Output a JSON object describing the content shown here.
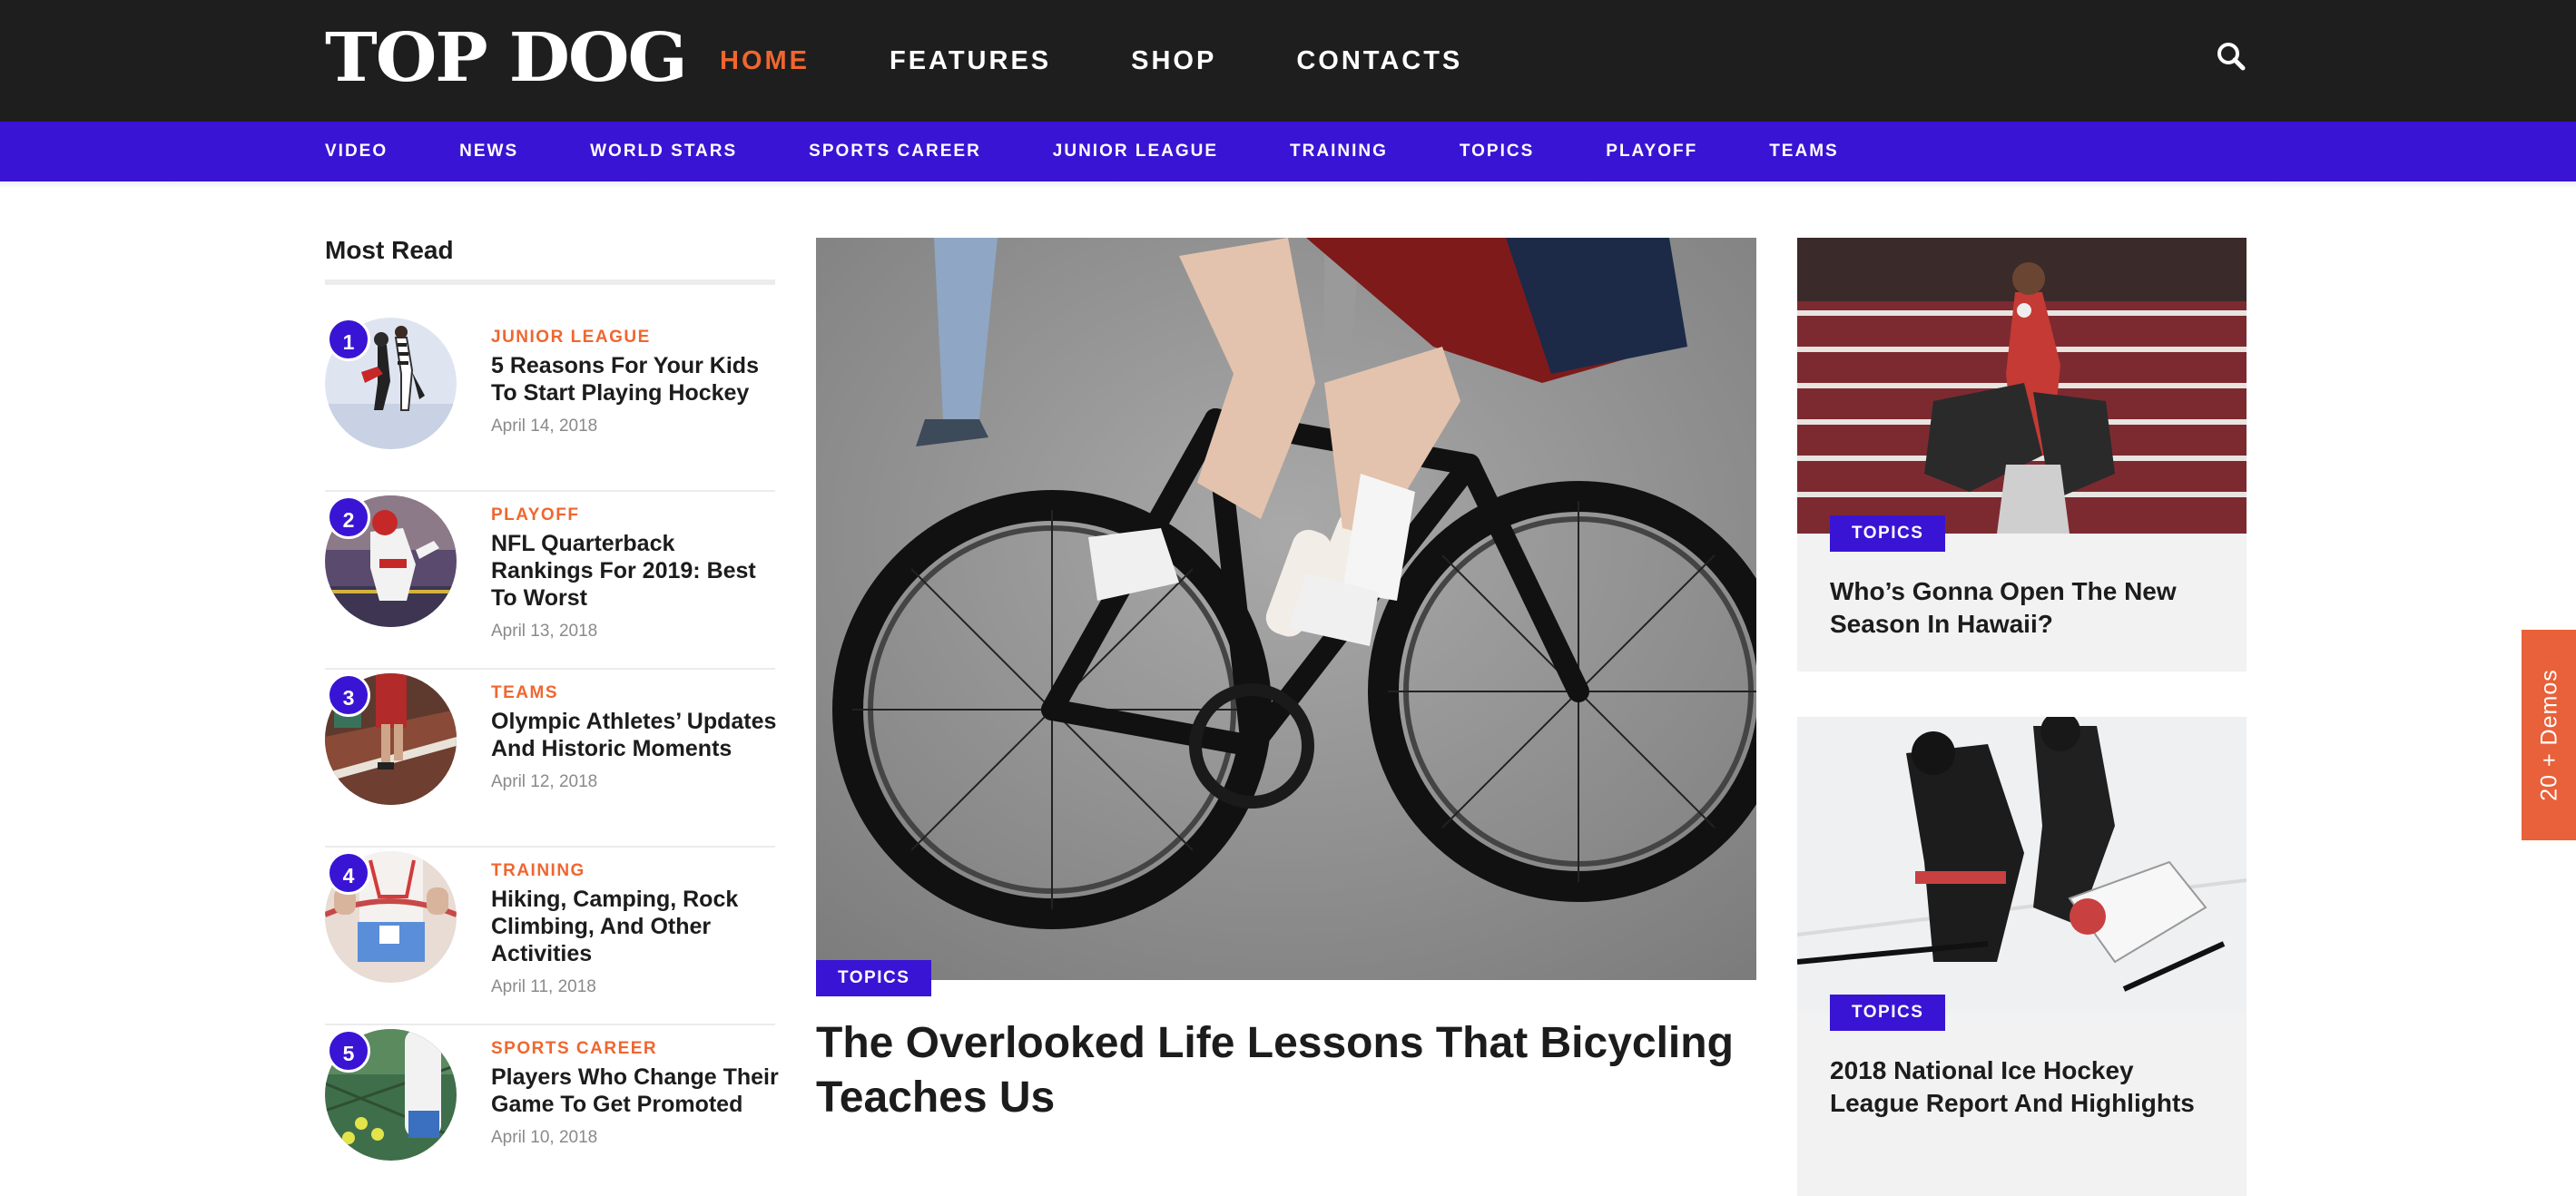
{
  "header": {
    "logo_text": "TOP DOG",
    "nav": [
      {
        "label": "HOME",
        "active": true
      },
      {
        "label": "FEATURES",
        "active": false
      },
      {
        "label": "SHOP",
        "active": false
      },
      {
        "label": "CONTACTS",
        "active": false
      }
    ],
    "search_icon": "search-icon"
  },
  "subnav": [
    "VIDEO",
    "NEWS",
    "WORLD STARS",
    "SPORTS CAREER",
    "JUNIOR LEAGUE",
    "TRAINING",
    "TOPICS",
    "PLAYOFF",
    "TEAMS"
  ],
  "most_read": {
    "title": "Most Read",
    "items": [
      {
        "num": "1",
        "category": "JUNIOR LEAGUE",
        "headline": "5 Reasons For Your Kids To Start Playing Hockey",
        "date": "April 14, 2018"
      },
      {
        "num": "2",
        "category": "PLAYOFF",
        "headline": "NFL Quarterback Rankings For 2019: Best To Worst",
        "date": "April 13, 2018"
      },
      {
        "num": "3",
        "category": "TEAMS",
        "headline": "Olympic Athletes’ Updates And Historic Moments",
        "date": "April 12, 2018"
      },
      {
        "num": "4",
        "category": "TRAINING",
        "headline": "Hiking, Camping, Rock Climbing, And Other Activities",
        "date": "April 11, 2018"
      },
      {
        "num": "5",
        "category": "SPORTS CAREER",
        "headline": "Players Who Change Their Game To Get Promoted",
        "date": "April 10, 2018"
      }
    ]
  },
  "feature": {
    "tag": "TOPICS",
    "title": "The Overlooked Life Lessons That Bicycling Teaches Us"
  },
  "side_cards": [
    {
      "tag": "TOPICS",
      "title": "Who’s Gonna Open The New Season In Hawaii?"
    },
    {
      "tag": "TOPICS",
      "title": "2018 National Ice Hockey League Report And Highlights"
    }
  ],
  "demos_tab": "20 + Demos",
  "colors": {
    "accent": "#f0662f",
    "brand": "#3a14d4",
    "header_bg": "#1e1e1e",
    "demos_bg": "#e8613a"
  }
}
